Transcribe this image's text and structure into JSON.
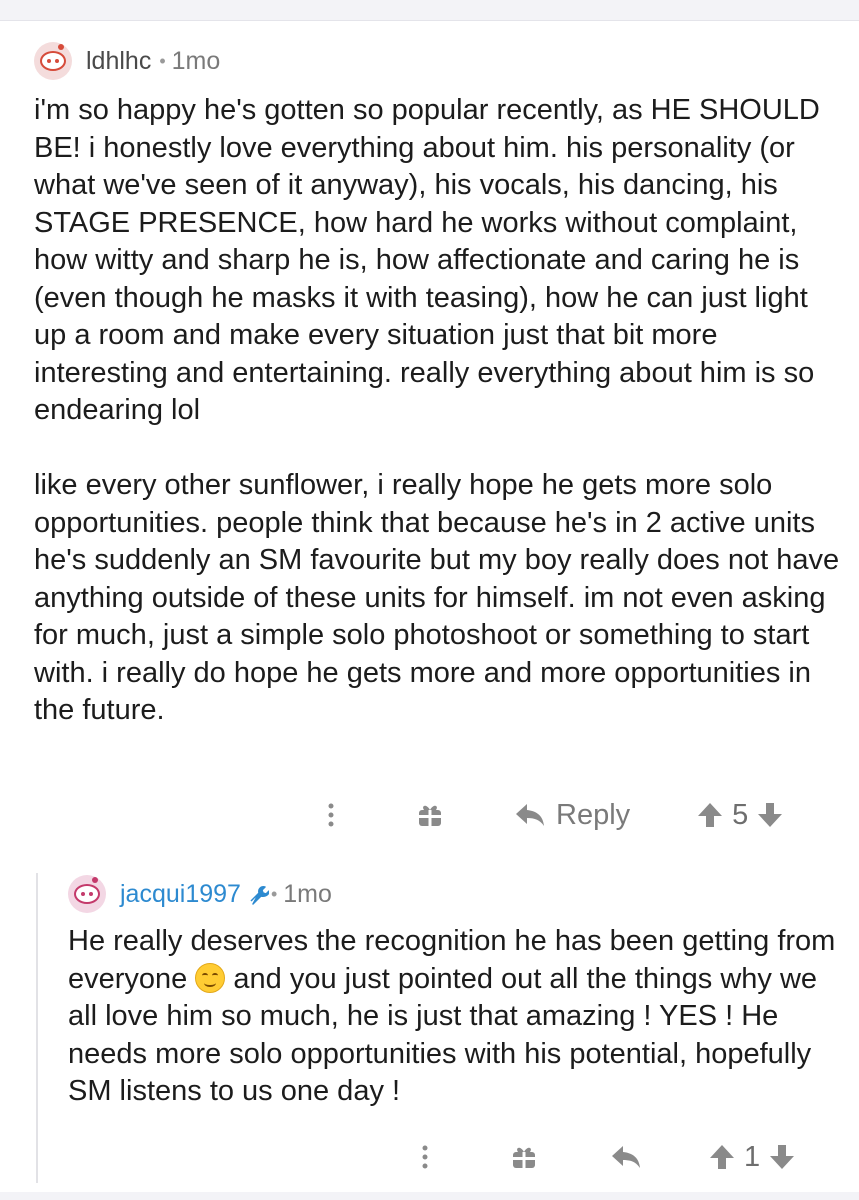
{
  "comments": [
    {
      "username": "ldhlhc",
      "separator": "•",
      "time": "1mo",
      "paragraphs": [
        "i'm so happy he's gotten so popular recently, as HE SHOULD BE! i honestly love everything about him. his personality (or what we've seen of it anyway), his vocals, his dancing, his STAGE PRESENCE, how hard he works without complaint, how witty and sharp he is, how affectionate and caring he is (even though he masks it with teasing), how he can just light up a room and make every situation just that bit more interesting and entertaining. really everything about him is so endearing lol",
        "like every other sunflower, i really hope he gets more solo opportunities. people think that because he's in 2 active units he's suddenly an SM favourite but my boy really does not have anything outside of these units for himself. im not even asking for much, just a simple solo photoshoot or something to start with. i really do hope he gets more and more opportunities in the future."
      ],
      "actions": {
        "reply_label": "Reply",
        "votes": "5"
      }
    },
    {
      "username": "jacqui1997",
      "separator": "•",
      "time": "1mo",
      "body_part1": "He really deserves the recognition he has been getting from everyone ",
      "body_part2": " and you just pointed out all the things why we all love him so much, he is just that amazing ! YES ! He needs more solo opportunities with his potential, hopefully SM listens to us one day !",
      "actions": {
        "votes": "1"
      }
    }
  ],
  "colors": {
    "background": "#ffffff",
    "text": "#1c1c1c",
    "username_primary": "#4a4a4a",
    "username_mod": "#2d8ad0",
    "muted": "#7a7a7a",
    "icon": "#8a8a8a"
  },
  "icons": [
    "avatar-snoo",
    "mod-wrench-icon",
    "more-options-icon",
    "gift-icon",
    "reply-arrow-icon",
    "upvote-arrow-icon",
    "downvote-arrow-icon",
    "smiling-emoji"
  ]
}
